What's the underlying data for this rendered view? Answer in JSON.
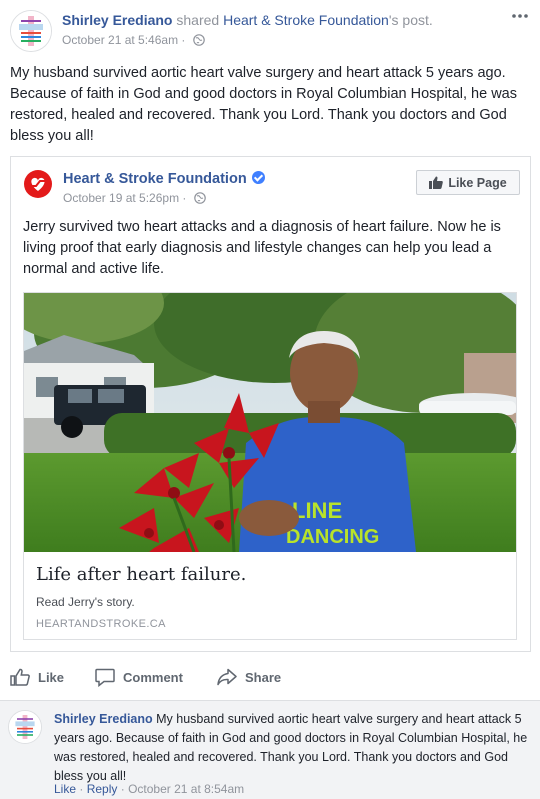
{
  "post": {
    "author": "Shirley Erediano",
    "shared_text": "shared",
    "source_link": "Heart & Stroke Foundation",
    "source_suffix": "'s post.",
    "date": "October 21 at 5:46am",
    "middot": "·",
    "text": "My husband survived aortic heart valve surgery and heart attack 5 years ago. Because of faith in God and good doctors in Royal Columbian Hospital, he was restored, healed and recovered. Thank you Lord. Thank you doctors and God bless you all!"
  },
  "shared_post": {
    "page_name": "Heart & Stroke Foundation",
    "date": "October 19 at 5:26pm",
    "middot": "·",
    "like_page_label": "Like Page",
    "text": "Jerry survived two heart attacks and a diagnosis of heart failure. Now he is living proof that early diagnosis and lifestyle changes can help you lead a normal and active life.",
    "link_card": {
      "title": "Life after heart failure.",
      "description": "Read Jerry's story.",
      "domain": "HEARTANDSTROKE.CA",
      "shirt_text_1": "LINE",
      "shirt_text_2": "DANCING"
    }
  },
  "actions": {
    "like": "Like",
    "comment": "Comment",
    "share": "Share"
  },
  "comment": {
    "author": "Shirley Erediano",
    "text": "My husband survived aortic heart valve surgery and heart attack 5 years ago. Because of faith in God and good doctors in Royal Columbian Hospital, he was restored, healed and recovered. Thank you Lord. Thank you doctors and God bless you all!",
    "like": "Like",
    "reply": "Reply",
    "sep": "·",
    "date": "October 21 at 8:54am"
  },
  "colors": {
    "link_blue": "#365899",
    "meta_gray": "#90949c",
    "brand_red": "#e31a1a",
    "verified_blue": "#4080ff"
  }
}
